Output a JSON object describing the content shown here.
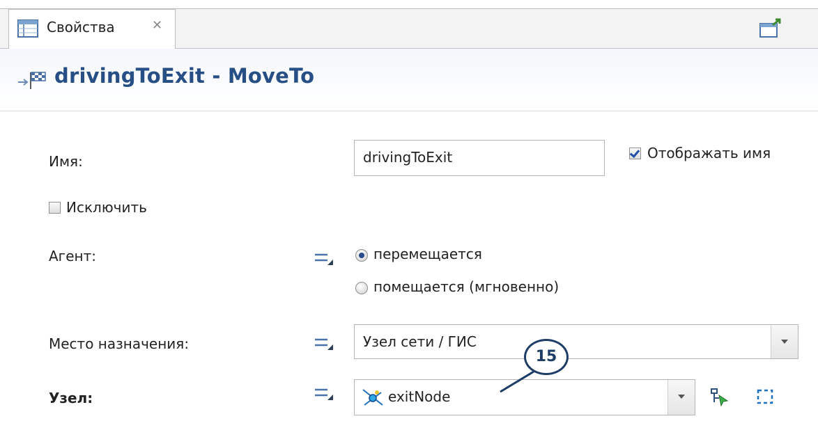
{
  "tab": {
    "label": "Свойства"
  },
  "header": {
    "title": "drivingToExit - MoveTo"
  },
  "form": {
    "name_label": "Имя:",
    "name_value": "drivingToExit",
    "show_name_label": "Отображать имя",
    "show_name_checked": true,
    "exclude_label": "Исключить",
    "exclude_checked": false,
    "agent_label": "Агент:",
    "agent_options": [
      "перемещается",
      "помещается (мгновенно)"
    ],
    "agent_selected": "перемещается",
    "destination_label": "Место назначения:",
    "destination_value": "Узел сети / ГИС",
    "node_label": "Узел:",
    "node_value": "exitNode"
  },
  "callout": {
    "number": "15"
  },
  "colors": {
    "header_title": "#274f85",
    "callout": "#1e3d66",
    "radio_dot": "#2b4a8c"
  },
  "icons": [
    "properties-view-icon",
    "close-tab-icon",
    "maximize-icon",
    "moveto-block-icon",
    "dynamic-value-icon",
    "node-icon",
    "select-node-icon",
    "highlight-node-icon"
  ]
}
